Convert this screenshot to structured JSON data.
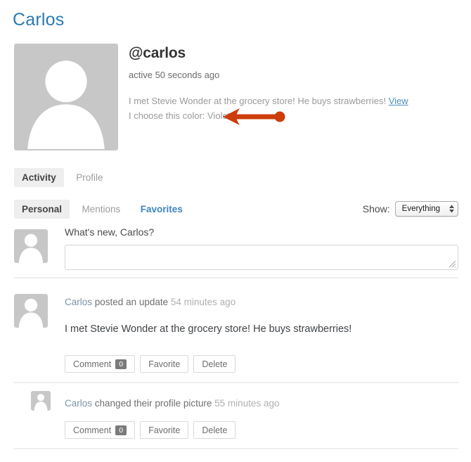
{
  "page": {
    "title": "Carlos"
  },
  "profile": {
    "avatar_icon": "user-avatar-placeholder-icon",
    "handle": "@carlos",
    "active_time": "active 50 seconds ago",
    "latest_update_text": "I met Stevie Wonder at the grocery store! He buys strawberries!",
    "latest_update_link": "View",
    "color_line": "I choose this color: Violet"
  },
  "annotation": {
    "name": "left-pointing-arrow",
    "color": "#cc3d0a"
  },
  "nav": {
    "primary": [
      {
        "label": "Activity",
        "state": "active"
      },
      {
        "label": "Profile",
        "state": "default"
      }
    ],
    "secondary": [
      {
        "label": "Personal",
        "state": "active"
      },
      {
        "label": "Mentions",
        "state": "default"
      },
      {
        "label": "Favorites",
        "state": "link"
      }
    ]
  },
  "filter": {
    "label": "Show:",
    "selected": "Everything",
    "options": [
      "Everything"
    ]
  },
  "post_form": {
    "prompt": "What's new, Carlos?",
    "value": "",
    "placeholder": ""
  },
  "activities": [
    {
      "user": "Carlos",
      "action": "posted an update",
      "time": "54 minutes ago",
      "content": "I met Stevie Wonder at the grocery store! He buys strawberries!",
      "buttons": {
        "comment_label": "Comment",
        "comment_count": "0",
        "favorite_label": "Favorite",
        "delete_label": "Delete"
      }
    },
    {
      "user": "Carlos",
      "action": "changed their profile picture",
      "time": "55 minutes ago",
      "content": "",
      "buttons": {
        "comment_label": "Comment",
        "comment_count": "0",
        "favorite_label": "Favorite",
        "delete_label": "Delete"
      }
    }
  ]
}
